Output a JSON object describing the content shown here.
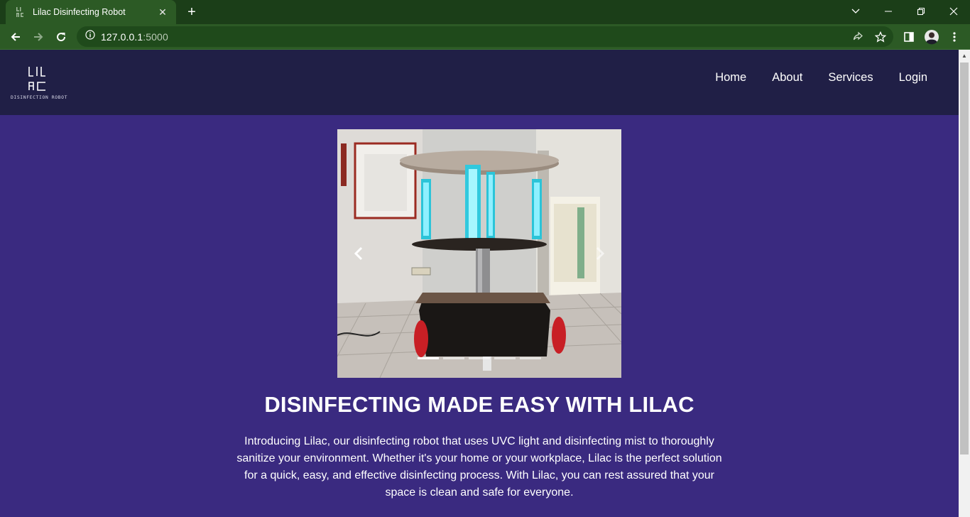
{
  "browser": {
    "tab_title": "Lilac Disinfecting Robot",
    "tab_close": "✕",
    "new_tab": "+",
    "url_host": "127.0.0.1",
    "url_port": ":5000",
    "icons": [
      "back-icon",
      "forward-icon",
      "reload-icon",
      "info-icon",
      "share-icon",
      "star-icon",
      "side-panel-icon",
      "profile-avatar",
      "menu-icon"
    ]
  },
  "site": {
    "logo": {
      "line1": "LIL",
      "line2": "AC",
      "tagline": "DISINFECTION ROBOT"
    },
    "nav": [
      "Home",
      "About",
      "Services",
      "Login"
    ],
    "carousel": {
      "slide_count": 5,
      "active_index": 0,
      "image_description": "UV robot photo"
    },
    "headline": "DISINFECTING MADE EASY WITH LILAC",
    "intro": "Introducing Lilac, our disinfecting robot that uses UVC light and disinfecting mist to thoroughly sanitize your environment. Whether it's your home or your workplace, Lilac is the perfect solution for a quick, easy, and effective disinfecting process. With Lilac, you can rest assured that your space is clean and safe for everyone."
  },
  "colors": {
    "chrome_frame": "#1b3e18",
    "chrome_toolbar": "#2c5a25",
    "site_nav": "#201f46",
    "page_bg": "#3a2a80",
    "text": "#ffffff"
  }
}
